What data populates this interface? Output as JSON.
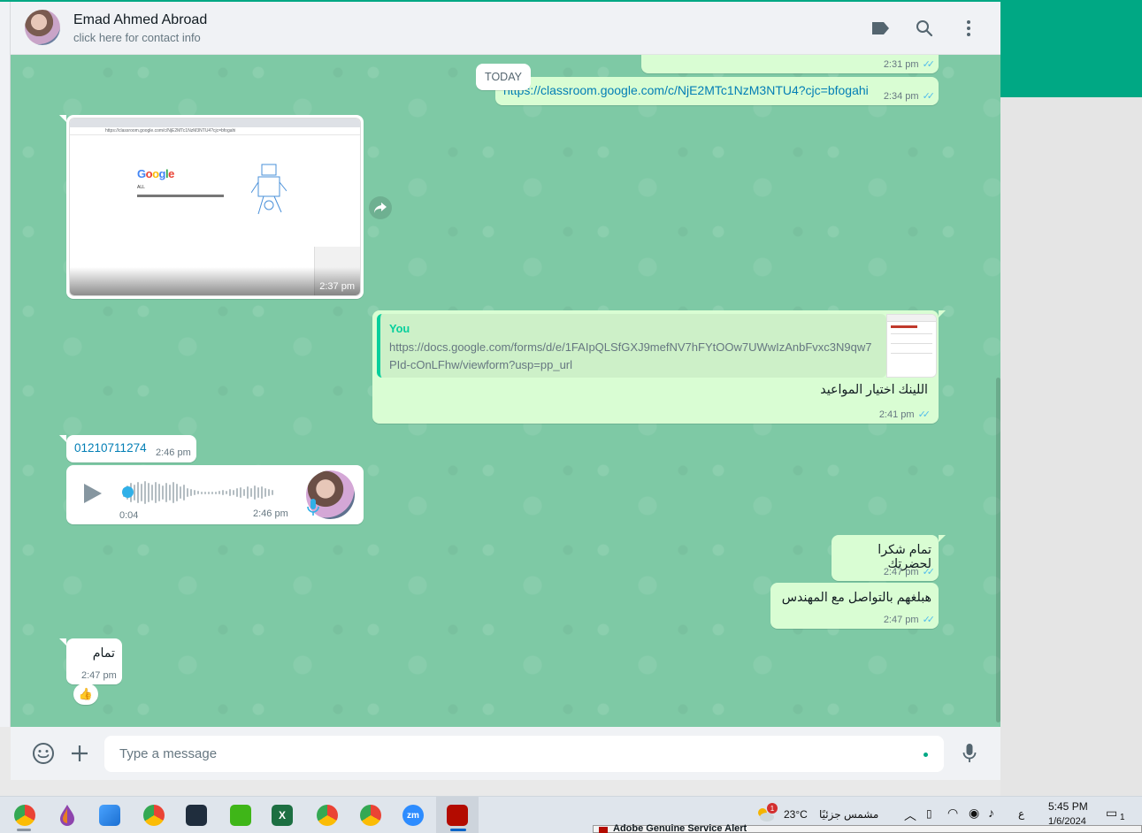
{
  "contact": {
    "name": "Emad Ahmed Abroad",
    "subtitle": "click here for contact info"
  },
  "header_icons": [
    "label-icon",
    "search-icon",
    "menu-icon"
  ],
  "date_separator": "TODAY",
  "messages": {
    "m1_time": "2:31 pm",
    "m2_link": "https://classroom.google.com/c/NjE2MTc1NzM3NTU4?cjc=bfogahi",
    "m2_time": "2:34 pm",
    "image_msg": {
      "time": "2:37 pm",
      "thumb_url": "https://classroom.google.com/c/NjE2MTc1NzM3NTU4?cjc=bfogahi",
      "thumb_brand": [
        "G",
        "o",
        "o",
        "g",
        "l",
        "e"
      ],
      "thumb_caption": "ALL"
    },
    "reply_msg": {
      "quote_from": "You",
      "quote_text": "https://docs.google.com/forms/d/e/1FAIpQLSfGXJ9mefNV7hFYtOOw7UWwIzAnbFvxc3N9qw7PId-cOnLFhw/viewform?usp=pp_url",
      "text": "اللينك اختيار المواعيد",
      "time": "2:41 pm"
    },
    "phone_msg": {
      "text": "01210711274",
      "time": "2:46 pm"
    },
    "voice_msg": {
      "duration": "0:04",
      "time": "2:46 pm"
    },
    "out_msg_1": {
      "text": "تمام شكرا لحضرتك",
      "time": "2:47 pm"
    },
    "out_msg_2": {
      "text": "هبلغهم بالتواصل مع المهندس",
      "time": "2:47 pm"
    },
    "in_msg_last": {
      "text": "تمام",
      "time": "2:47 pm",
      "reaction": "👍"
    }
  },
  "composer": {
    "placeholder": "Type a message"
  },
  "taskbar": {
    "weather_temp": "23°C",
    "weather_text": "مشمس جزئيًا",
    "weather_badge": "1",
    "lang": "ع",
    "time": "5:45 PM",
    "date": "1/6/2024",
    "notif_count": "1",
    "popup_title": "Adobe Genuine Service Alert"
  },
  "colors": {
    "accent": "#00a884",
    "outgoing": "#d9fdd3",
    "chat_bg": "#7ec9a5",
    "ticks": "#53bdeb"
  }
}
